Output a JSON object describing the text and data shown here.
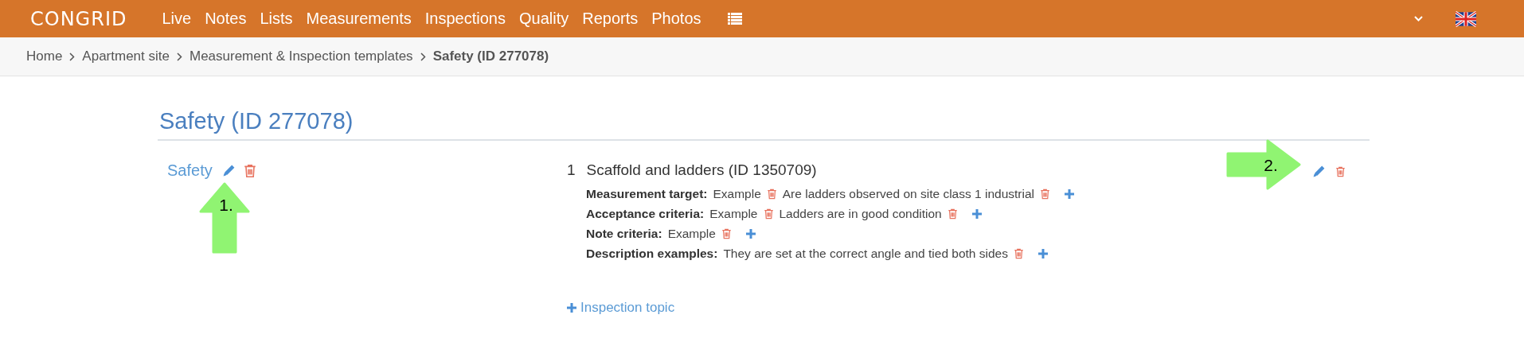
{
  "navbar": {
    "logo": "CONGRID",
    "items": [
      "Live",
      "Notes",
      "Lists",
      "Measurements",
      "Inspections",
      "Quality",
      "Reports",
      "Photos"
    ]
  },
  "breadcrumb": [
    {
      "label": "Home",
      "current": false
    },
    {
      "label": "Apartment site",
      "current": false
    },
    {
      "label": "Measurement & Inspection templates",
      "current": false
    },
    {
      "label": "Safety (ID 277078)",
      "current": true
    }
  ],
  "page_title": "Safety (ID 277078)",
  "category": {
    "name": "Safety",
    "topics": [
      {
        "number": "1",
        "title": "Scaffold and ladders (ID 1350709)",
        "fields": [
          {
            "label": "Measurement target:",
            "values": [
              "Example",
              "Are ladders observed on site class 1 industrial"
            ]
          },
          {
            "label": "Acceptance criteria:",
            "values": [
              "Example",
              "Ladders are in good condition"
            ]
          },
          {
            "label": "Note criteria:",
            "values": [
              "Example"
            ]
          },
          {
            "label": "Description examples:",
            "values": [
              "They are set at the correct angle and tied both sides"
            ]
          }
        ]
      }
    ]
  },
  "add_topic_label": "Inspection topic",
  "annotations": [
    {
      "label": "1.",
      "kind": "up"
    },
    {
      "label": "2.",
      "kind": "right"
    }
  ]
}
